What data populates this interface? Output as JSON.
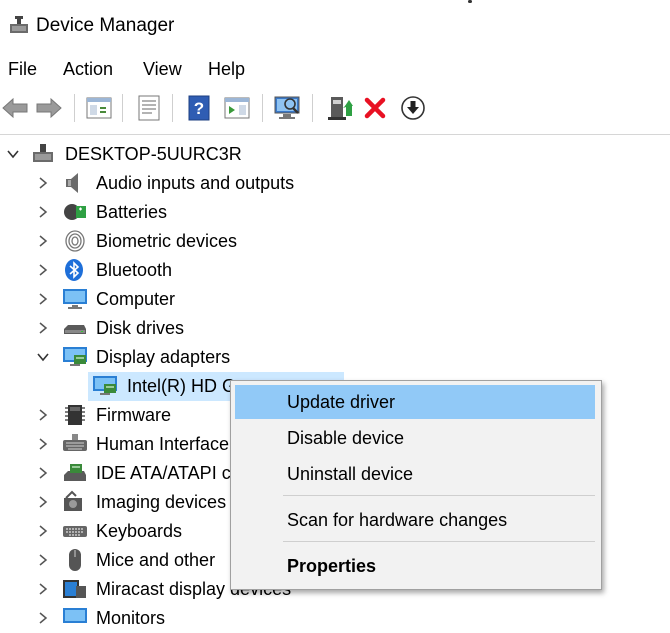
{
  "window": {
    "title": "Device Manager"
  },
  "menu": [
    "File",
    "Action",
    "View",
    "Help"
  ],
  "toolbar": [
    {
      "icon": "back-arrow-icon"
    },
    {
      "icon": "forward-arrow-icon"
    },
    {
      "icon": "show-hide-console-tree-icon"
    },
    {
      "icon": "properties-icon"
    },
    {
      "icon": "help-icon"
    },
    {
      "icon": "action-pane-icon"
    },
    {
      "icon": "scan-hardware-changes-icon"
    },
    {
      "icon": "update-driver-icon"
    },
    {
      "icon": "uninstall-device-icon"
    },
    {
      "icon": "download-icon"
    }
  ],
  "tree": {
    "root": "DESKTOP-5UURC3R",
    "items": [
      {
        "label": "Audio inputs and outputs",
        "icon": "speaker-icon"
      },
      {
        "label": "Batteries",
        "icon": "battery-icon"
      },
      {
        "label": "Biometric devices",
        "icon": "fingerprint-icon"
      },
      {
        "label": "Bluetooth",
        "icon": "bluetooth-icon"
      },
      {
        "label": "Computer",
        "icon": "computer-icon"
      },
      {
        "label": "Disk drives",
        "icon": "disk-drive-icon"
      },
      {
        "label": "Display adapters",
        "icon": "display-adapter-icon",
        "expanded": true
      },
      {
        "label": "Intel(R) HD G",
        "icon": "display-adapter-icon",
        "child": true,
        "selected": true
      },
      {
        "label": "Firmware",
        "icon": "firmware-icon"
      },
      {
        "label": "Human Interface",
        "icon": "hid-icon"
      },
      {
        "label": "IDE ATA/ATAPI co",
        "icon": "ide-controller-icon"
      },
      {
        "label": "Imaging devices",
        "icon": "camera-icon"
      },
      {
        "label": "Keyboards",
        "icon": "keyboard-icon"
      },
      {
        "label": "Mice and other",
        "icon": "mouse-icon"
      },
      {
        "label": "Miracast display devices",
        "icon": "miracast-icon"
      },
      {
        "label": "Monitors",
        "icon": "monitor-icon"
      }
    ]
  },
  "context_menu": {
    "items": [
      {
        "label": "Update driver",
        "highlighted": true
      },
      {
        "label": "Disable device"
      },
      {
        "label": "Uninstall device"
      },
      {
        "separator": true
      },
      {
        "label": "Scan for hardware changes"
      },
      {
        "separator": true
      },
      {
        "label": "Properties",
        "bold": true
      }
    ]
  },
  "colors": {
    "selection": "#cce8ff",
    "menu_highlight": "#91c9f7",
    "menu_bg": "#f2f2f2",
    "uninstall_red": "#e81123"
  }
}
